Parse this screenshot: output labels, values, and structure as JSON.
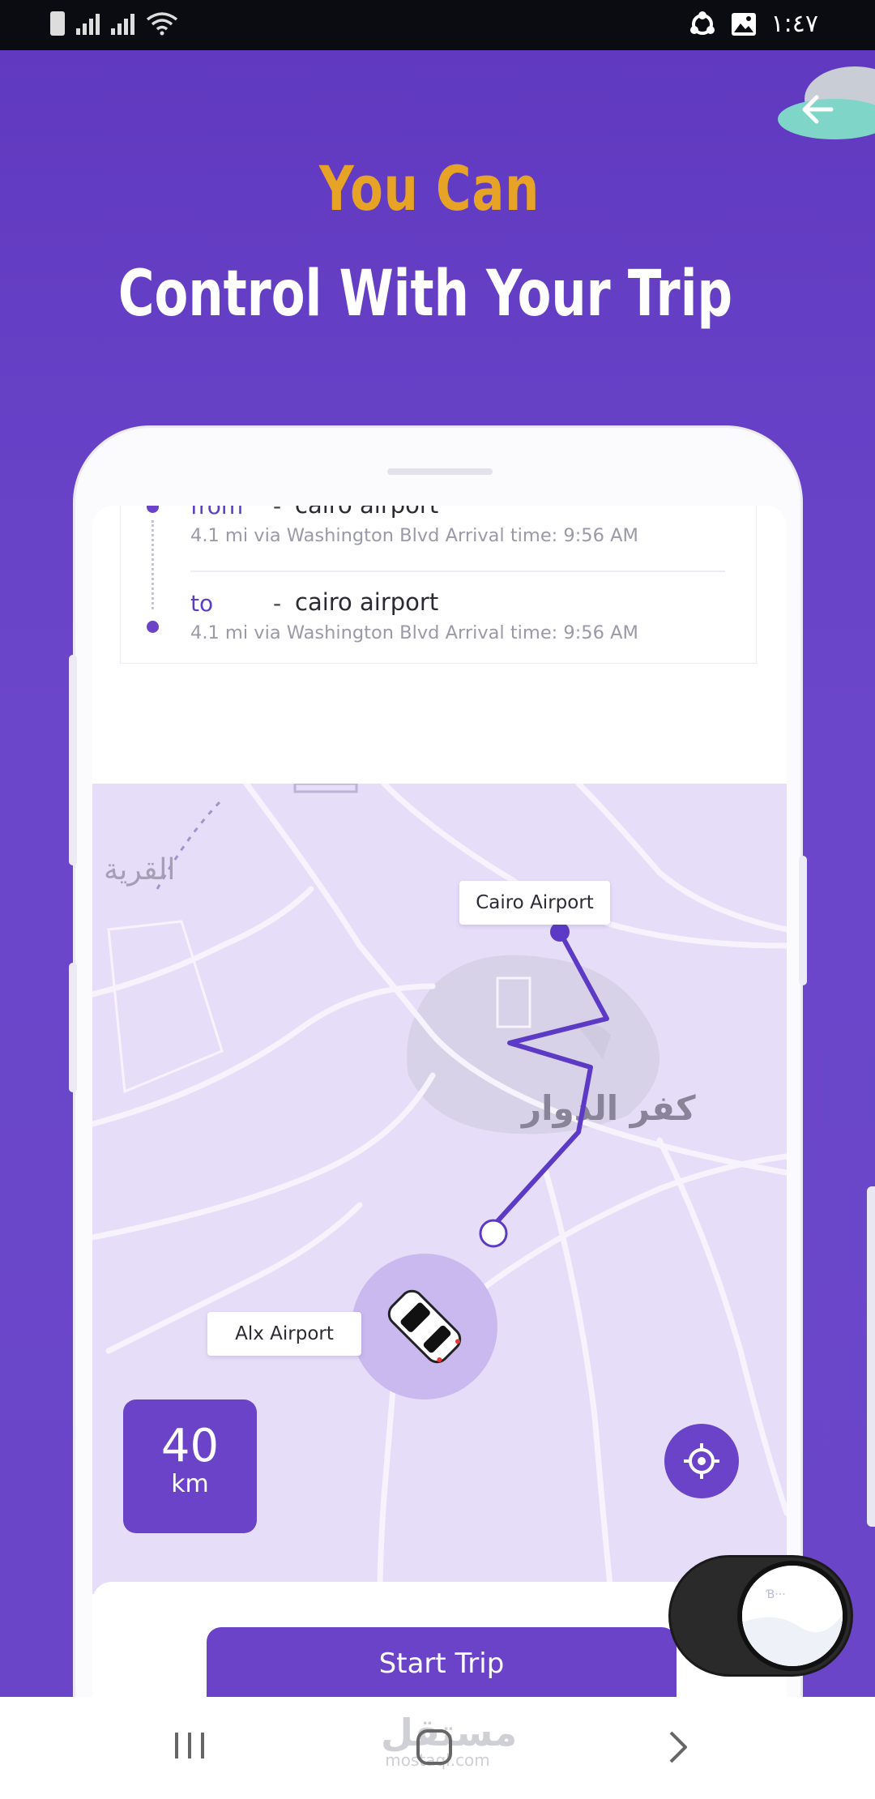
{
  "status_bar": {
    "time": "١:٤٧",
    "icons": [
      "battery-icon",
      "signal-icon",
      "signal-icon",
      "wifi-icon",
      "sync-icon",
      "gallery-icon"
    ]
  },
  "header": {
    "title_line1": "You Can",
    "title_line2": "Control With Your Trip",
    "back_icon": "arrow-left-icon"
  },
  "trip_card": {
    "from": {
      "label": "from",
      "dash": "-",
      "destination": "cairo airport",
      "info": "4.1 mi via Washington Blvd Arrival time: 9:56 AM"
    },
    "to": {
      "label": "to",
      "dash": "-",
      "destination": "cairo airport",
      "info": "4.1 mi via Washington Blvd Arrival time: 9:56 AM"
    }
  },
  "map": {
    "destination_label": "Cairo Airport",
    "origin_label": "Alx Airport",
    "place_arabic_1": "كفر الدوار",
    "place_arabic_2": "القرية",
    "distance_value": "40",
    "distance_unit": "km",
    "locate_icon": "locate-target-icon"
  },
  "actions": {
    "start_trip": "Start Trip"
  },
  "navbar": {
    "watermark": "مستقل",
    "watermark_sub": "mostaql.com",
    "recents_icon": "recents-icon",
    "home_icon": "home-icon",
    "back_icon": "chevron-right-icon"
  },
  "colors": {
    "background": "#6a45c8",
    "accent": "#6a43c9",
    "title_yellow": "#e7a325",
    "map_bg": "#e6def9"
  }
}
